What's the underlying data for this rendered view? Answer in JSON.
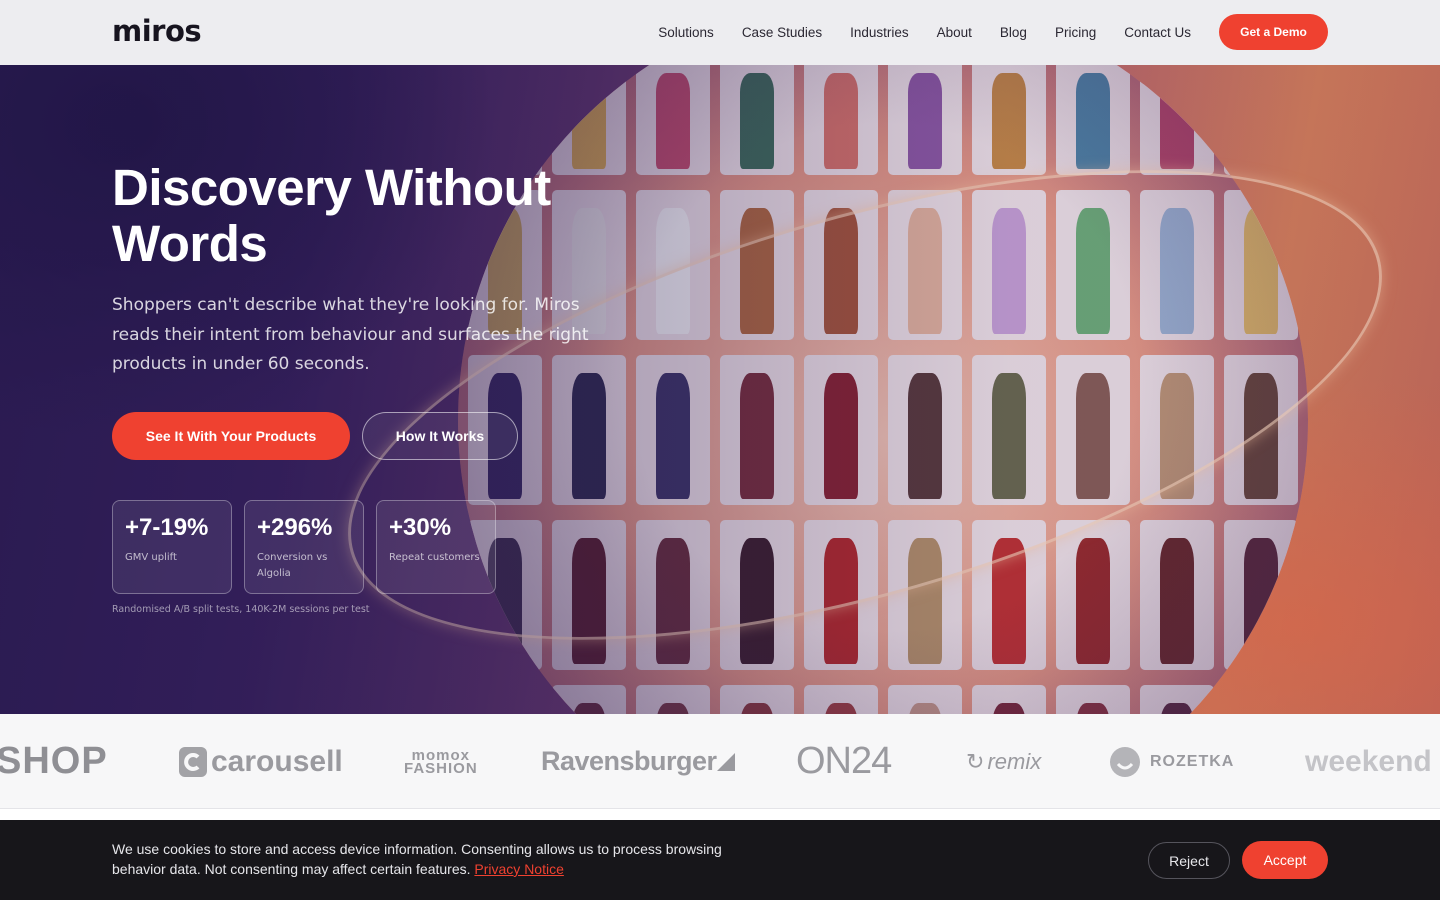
{
  "nav": {
    "logo": "miros",
    "links": [
      "Solutions",
      "Case Studies",
      "Industries",
      "About",
      "Blog",
      "Pricing",
      "Contact Us"
    ],
    "cta": "Get a Demo"
  },
  "hero": {
    "title": "Discovery Without Words",
    "subtitle": "Shoppers can't describe what they're looking for. Miros reads their intent from behaviour and surfaces the right products in under 60 seconds.",
    "primary_cta": "See It With Your Products",
    "secondary_cta": "How It Works",
    "stats": [
      {
        "value": "+7-19%",
        "label": "GMV uplift"
      },
      {
        "value": "+296%",
        "label": "Conversion vs Algolia"
      },
      {
        "value": "+30%",
        "label": "Repeat customers"
      }
    ],
    "stats_note": "Randomised A/B split tests, 140K-2M sessions per test",
    "image": "globe-of-dress-product-tiles"
  },
  "logos": [
    "SHOP",
    "carousell",
    "momox FASHION",
    "Ravensburger",
    "ON24",
    "remix",
    "ROZETKA",
    "weekend"
  ],
  "cookie": {
    "text": "We use cookies to store and access device information. Consenting allows us to process browsing behavior data. Not consenting may affect certain features.",
    "privacy_link": "Privacy Notice",
    "reject": "Reject",
    "accept": "Accept"
  },
  "colors": {
    "accent": "#ef4130",
    "nav_bg": "#ededf0",
    "hero_purple": "#3a2260",
    "hero_orange": "#d8805a",
    "cookie_bg": "#17161a"
  }
}
